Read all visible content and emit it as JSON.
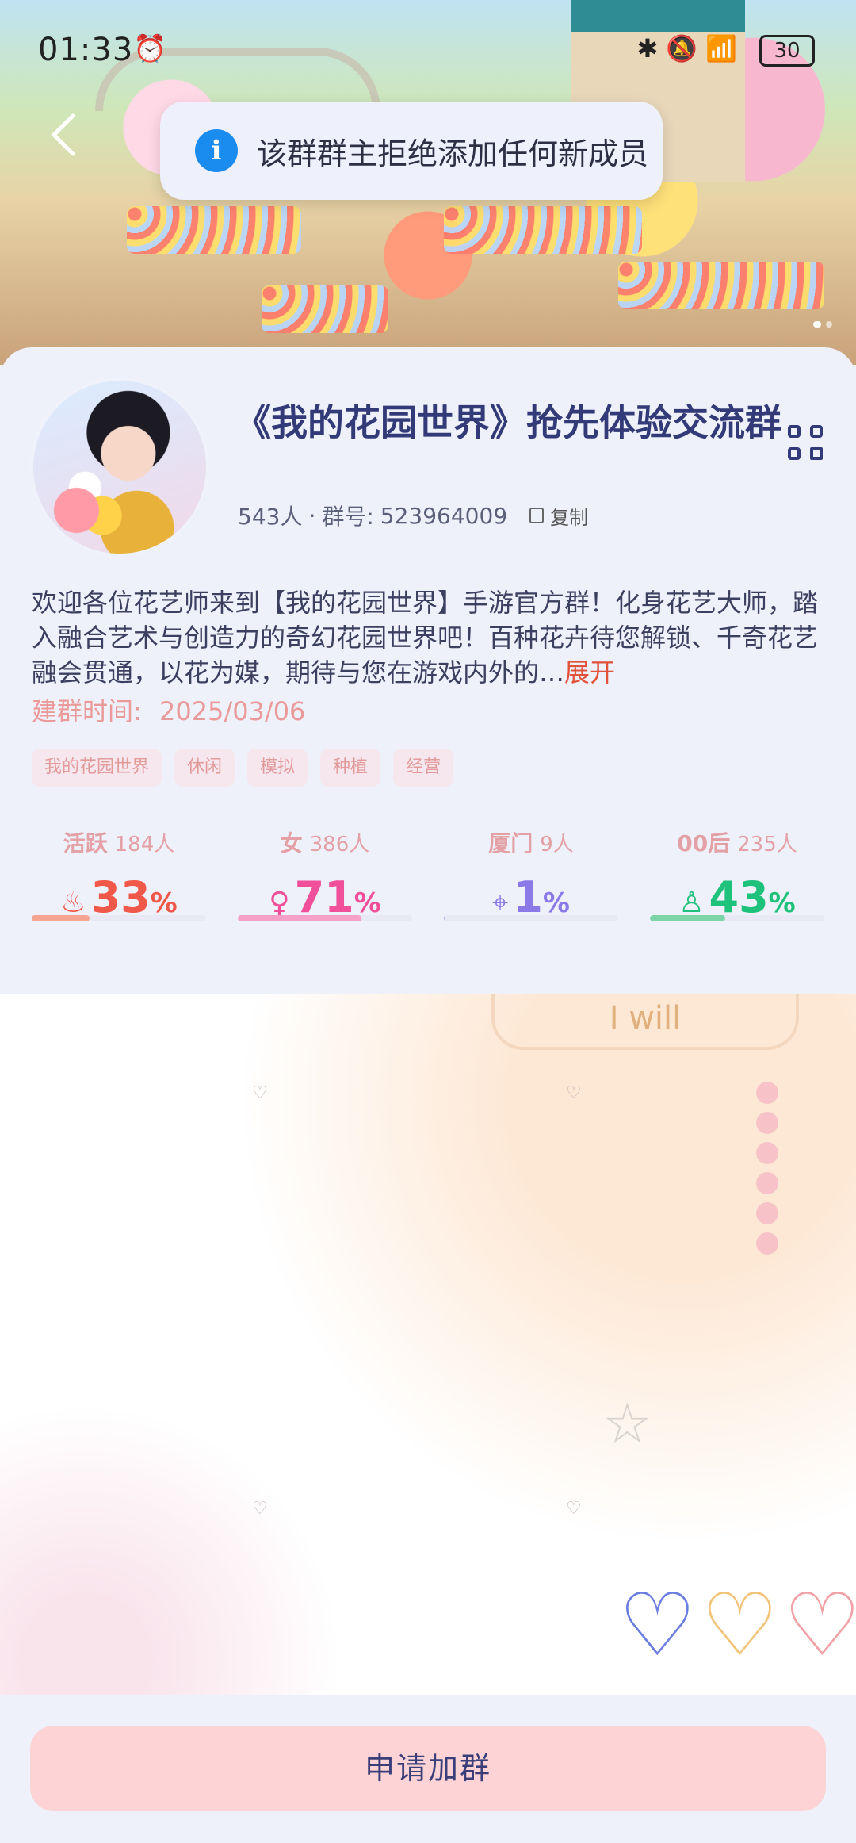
{
  "status_bar": {
    "time": "01:33",
    "battery": "30"
  },
  "toast": {
    "message": "该群群主拒绝添加任何新成员"
  },
  "group": {
    "title": "《我的花园世界》抢先体验交流群",
    "members": "543人",
    "group_id_label": "群号:",
    "group_id": "523964009",
    "copy_label": "复制",
    "description": "欢迎各位花艺师来到【我的花园世界】手游官方群！化身花艺大师，踏入融合艺术与创造力的奇幻花园世界吧！百种花卉待您解锁、千奇花艺融会贯通，以花为媒，期待与您在游戏内外的…",
    "expand_label": "展开",
    "created_label": "建群时间:",
    "created_date": "2025/03/06",
    "tags": [
      "我的花园世界",
      "休闲",
      "模拟",
      "种植",
      "经营"
    ]
  },
  "stats": [
    {
      "label": "活跃",
      "count": "184人",
      "value": "33",
      "unit": "%",
      "icon": "fire-icon",
      "color": "#f0584a",
      "fill": 0.33,
      "bar_color": "#f5a492"
    },
    {
      "label": "女",
      "count": "386人",
      "value": "71",
      "unit": "%",
      "icon": "female-icon",
      "color": "#f0509a",
      "fill": 0.71,
      "bar_color": "#f5a0c8"
    },
    {
      "label": "厦门",
      "count": "9人",
      "value": "1",
      "unit": "%",
      "icon": "location-icon",
      "color": "#8c79e8",
      "fill": 0.01,
      "bar_color": "#b8a6f0"
    },
    {
      "label": "00后",
      "count": "235人",
      "value": "43",
      "unit": "%",
      "icon": "person-icon",
      "color": "#1ec27a",
      "fill": 0.43,
      "bar_color": "#7dd4a6"
    }
  ],
  "decor": {
    "bubble_text": "I will"
  },
  "footer": {
    "join_label": "申请加群"
  }
}
